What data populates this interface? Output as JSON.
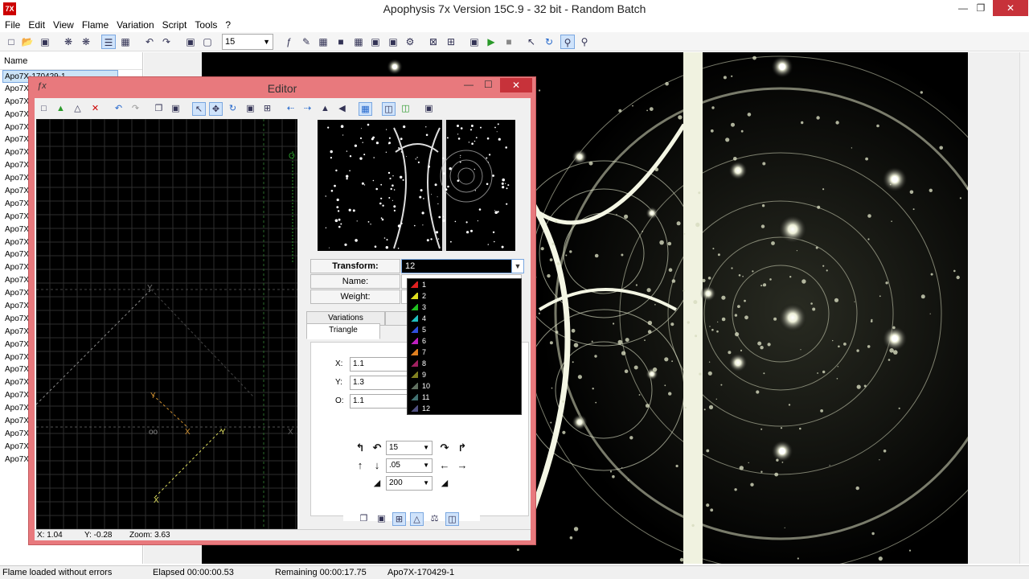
{
  "window": {
    "title": "Apophysis 7x Version 15C.9  - 32 bit - Random Batch",
    "app_icon": "7X"
  },
  "menu": [
    "File",
    "Edit",
    "View",
    "Flame",
    "Variation",
    "Script",
    "Tools",
    "?"
  ],
  "toolbar": {
    "quality_value": "15"
  },
  "list": {
    "header": "Name",
    "selected": "Apo7X-170429-1",
    "items": [
      "Apo7X",
      "Apo7X",
      "Apo7X",
      "Apo7X",
      "Apo7X",
      "Apo7X",
      "Apo7X",
      "Apo7X",
      "Apo7X",
      "Apo7X",
      "Apo7X",
      "Apo7X",
      "Apo7X",
      "Apo7X",
      "Apo7X",
      "Apo7X",
      "Apo7X",
      "Apo7X",
      "Apo7X",
      "Apo7X",
      "Apo7X",
      "Apo7X",
      "Apo7X",
      "Apo7X",
      "Apo7X",
      "Apo7X",
      "Apo7X",
      "Apo7X",
      "Apo7X",
      "Apo7X"
    ]
  },
  "status": {
    "message": "Flame loaded without errors",
    "elapsed": "Elapsed 00:00:00.53",
    "remaining": "Remaining 00:00:17.75",
    "name": "Apo7X-170429-1"
  },
  "editor": {
    "title": "Editor",
    "transform_label": "Transform:",
    "transform_value": "12",
    "name_label": "Name:",
    "weight_label": "Weight:",
    "tab_variations": "Variations",
    "tab_triangle": "Triangle",
    "x_label": "X:",
    "x_value": "1.1",
    "y_label": "Y:",
    "y_value": "1.3",
    "o_label": "O:",
    "o_value": "1.1",
    "rotate_value": "15",
    "move_value": ".05",
    "scale_value": "200",
    "status_x": "X: 1.04",
    "status_y": "Y: -0.28",
    "status_zoom": "Zoom: 3.63",
    "transforms": [
      {
        "label": "1",
        "color": "#e02020"
      },
      {
        "label": "2",
        "color": "#e0e020"
      },
      {
        "label": "3",
        "color": "#20c020"
      },
      {
        "label": "4",
        "color": "#20c0c0"
      },
      {
        "label": "5",
        "color": "#3050e0"
      },
      {
        "label": "6",
        "color": "#c020c0"
      },
      {
        "label": "7",
        "color": "#e08020"
      },
      {
        "label": "8",
        "color": "#a02060"
      },
      {
        "label": "9",
        "color": "#808020"
      },
      {
        "label": "10",
        "color": "#607060"
      },
      {
        "label": "11",
        "color": "#407070"
      },
      {
        "label": "12",
        "color": "#505080"
      }
    ]
  }
}
